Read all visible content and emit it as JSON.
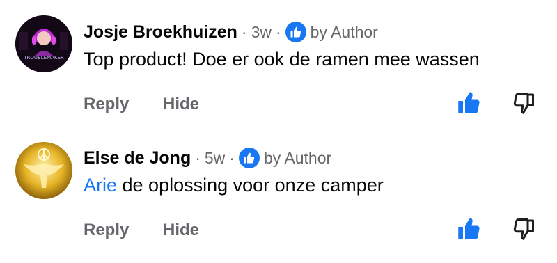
{
  "comments": [
    {
      "author": "Josje Broekhuizen",
      "time": "3w",
      "author_badge": "by Author",
      "avatar_icon": "gamer-avatar",
      "avatar_caption": "TROUBLEMAKER",
      "mention": "",
      "text": "Top product! Doe er ook de ramen mee wassen",
      "reply_label": "Reply",
      "hide_label": "Hide"
    },
    {
      "author": "Else de Jong",
      "time": "5w",
      "author_badge": "by Author",
      "avatar_icon": "golden-dove-peace-avatar",
      "mention": "Arie",
      "text": " de oplossing voor onze camper",
      "reply_label": "Reply",
      "hide_label": "Hide"
    }
  ],
  "colors": {
    "accent": "#1877f2",
    "secondary_text": "#65676b",
    "primary_text": "#050505"
  },
  "icons": [
    "thumbs-up-icon",
    "thumbs-down-icon"
  ]
}
